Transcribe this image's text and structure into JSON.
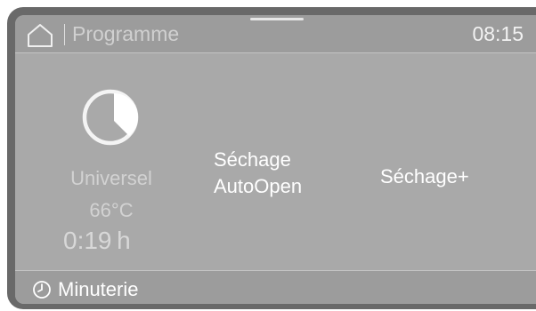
{
  "header": {
    "title": "Programme",
    "time": "08:15",
    "home_icon": "home-icon"
  },
  "program": {
    "icon": "pie-progress-icon",
    "name": "Universel",
    "temperature": "66°C",
    "duration": "0:19 h"
  },
  "options": {
    "option_1_line_1": "Séchage",
    "option_1_line_2": "AutoOpen",
    "option_2": "Séchage+"
  },
  "footer": {
    "timer_icon": "clock-icon",
    "timer_label": "Minuterie"
  },
  "colors": {
    "frame": "#696969",
    "screen": "#a9a9a9",
    "bars": "#9c9c9c",
    "text": "#ffffff"
  }
}
